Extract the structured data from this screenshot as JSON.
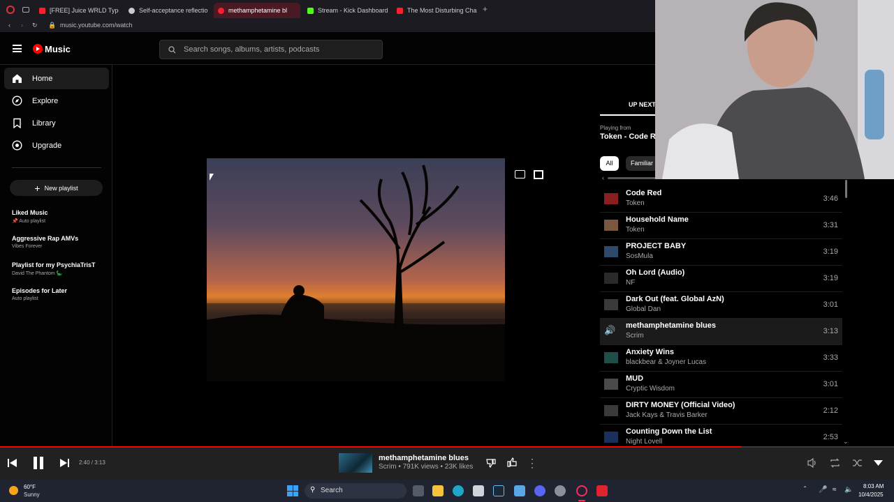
{
  "browser": {
    "tabs": [
      {
        "label": "[FREE] Juice WRLD Type",
        "color": "#ff1e2d"
      },
      {
        "label": "Self-acceptance reflectio",
        "color": "#cccccc"
      },
      {
        "label": "methamphetamine bl",
        "color": "#ff1e2d"
      },
      {
        "label": "Stream - Kick Dashboard",
        "color": "#53fc18"
      },
      {
        "label": "The Most Disturbing Cha",
        "color": "#ff1e2d"
      }
    ],
    "address": "music.youtube.com/watch"
  },
  "header": {
    "logo": "Music",
    "search_placeholder": "Search songs, albums, artists, podcasts"
  },
  "sidebar": {
    "nav": [
      {
        "label": "Home",
        "icon": "home-icon"
      },
      {
        "label": "Explore",
        "icon": "compass-icon"
      },
      {
        "label": "Library",
        "icon": "bookmark-icon"
      },
      {
        "label": "Upgrade",
        "icon": "upgrade-icon"
      }
    ],
    "new_playlist": "New playlist",
    "playlists": [
      {
        "title": "Liked Music",
        "subtitle": "Auto playlist",
        "pinned": true
      },
      {
        "title": "Aggressive Rap AMVs",
        "subtitle": "Vibes Forever"
      },
      {
        "title": "Playlist for my PsychiaTrisT",
        "subtitle": "David The Phantom 🦕"
      },
      {
        "title": "Episodes for Later",
        "subtitle": "Auto playlist"
      }
    ]
  },
  "right_panel": {
    "tab_up_next": "UP NEXT",
    "playing_from_label": "Playing from",
    "playing_from_value": "Token - Code Re",
    "chips": [
      "All",
      "Familiar"
    ],
    "queue": [
      {
        "title": "Code Red",
        "artist": "Token",
        "duration": "3:46"
      },
      {
        "title": "Household Name",
        "artist": "Token",
        "duration": "3:31"
      },
      {
        "title": "PROJECT BABY",
        "artist": "SosMula",
        "duration": "3:19"
      },
      {
        "title": "Oh Lord (Audio)",
        "artist": "NF",
        "duration": "3:19"
      },
      {
        "title": "Dark Out (feat. Global AzN)",
        "artist": "Global Dan",
        "duration": "3:01"
      },
      {
        "title": "methamphetamine blues",
        "artist": "Scrim",
        "duration": "3:13",
        "current": true
      },
      {
        "title": "Anxiety Wins",
        "artist": "blackbear & Joyner Lucas",
        "duration": "3:33"
      },
      {
        "title": "MUD",
        "artist": "Cryptic Wisdom",
        "duration": "3:01"
      },
      {
        "title": "DIRTY MONEY (Official Video)",
        "artist": "Jack Kays & Travis Barker",
        "duration": "2:12"
      },
      {
        "title": "Counting Down the List",
        "artist": "Night Lovell",
        "duration": "2:53"
      }
    ]
  },
  "player": {
    "time": "2:40 / 3:13",
    "progress_fraction": 0.829,
    "title": "methamphetamine blues",
    "meta": "Scrim • 791K views • 23K likes"
  },
  "taskbar": {
    "weather_temp": "60°F",
    "weather_desc": "Sunny",
    "search_label": "Search",
    "time": "8:03 AM",
    "date": "10/4/2025"
  },
  "colors": {
    "accent": "#ff0000",
    "background": "#030303",
    "panel": "#212121"
  }
}
